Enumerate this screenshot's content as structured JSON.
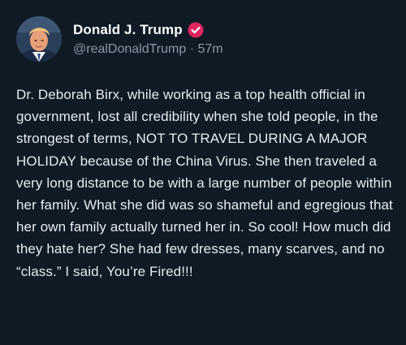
{
  "author": {
    "display_name": "Donald J. Trump",
    "handle": "@realDonaldTrump",
    "separator": "·",
    "time_ago": "57m",
    "verified": true,
    "avatar_icon": "profile-photo",
    "verified_icon": "verified-badge-icon"
  },
  "post": {
    "text": "Dr. Deborah Birx, while working as a top health official in government, lost all credibility when she told people, in the strongest of terms, NOT TO TRAVEL DURING A MAJOR HOLIDAY because of the China Virus. She then traveled a very long distance to be with a large number of people within her family. What she did was so shameful and egregious that her own family actually turned her in. So cool! How much did they hate her? She had few dresses, many scarves, and no “class.” I said, You’re Fired!!!"
  },
  "colors": {
    "background": "#0f1a24",
    "verified_badge": "#e0245e",
    "secondary_text": "#8b98a5"
  }
}
